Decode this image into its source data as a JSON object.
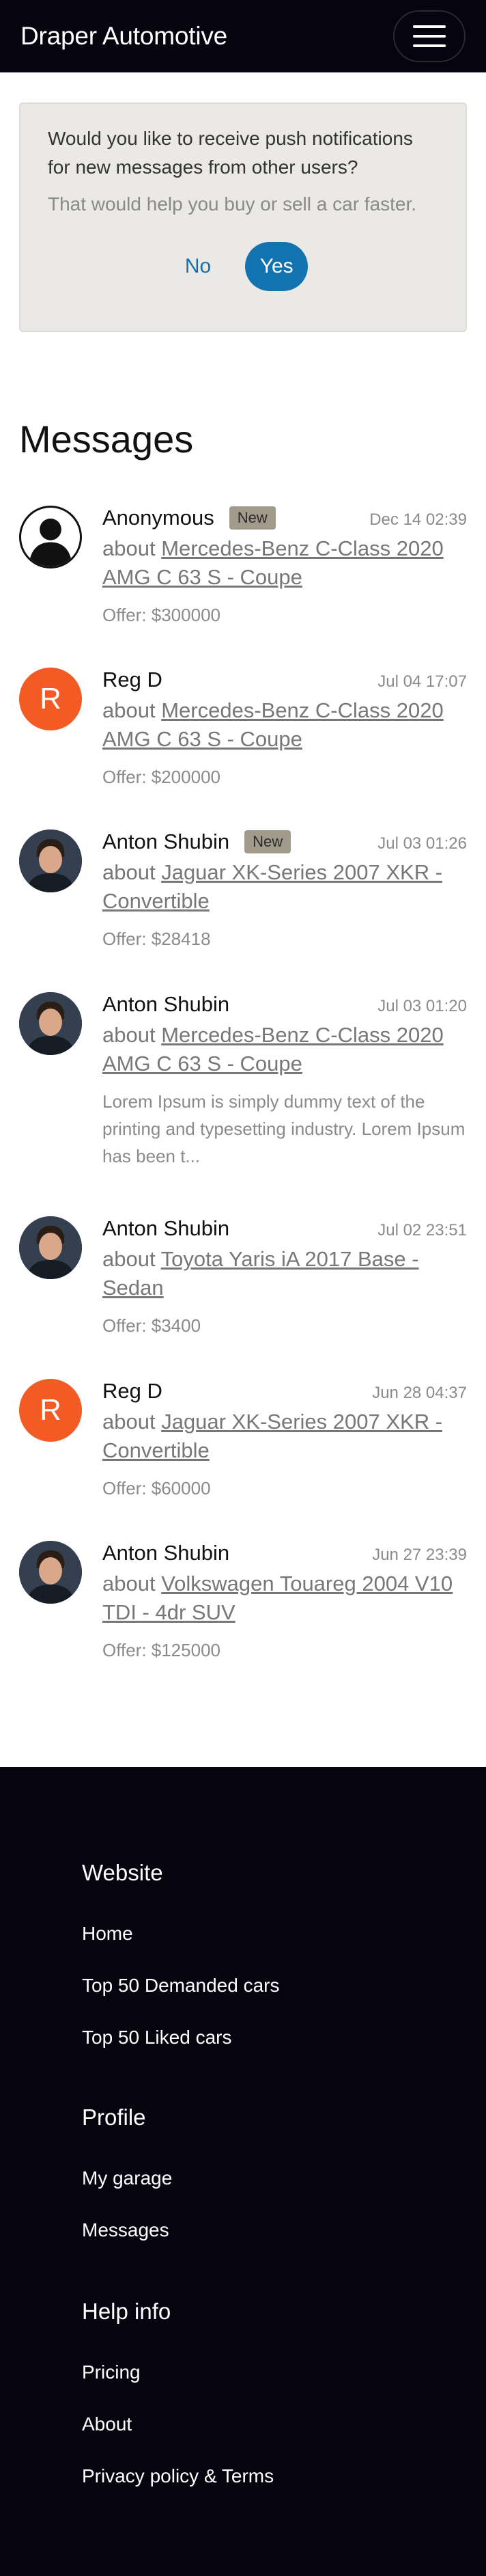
{
  "header": {
    "brand": "Draper Automotive",
    "menu_icon": "hamburger-icon"
  },
  "notification": {
    "question": "Would you like to receive push notifications for new messages from other users?",
    "hint": "That would help you buy or sell a car faster.",
    "no_label": "No",
    "yes_label": "Yes"
  },
  "page": {
    "title": "Messages"
  },
  "messages": [
    {
      "name": "Anonymous",
      "badge": "New",
      "date": "Dec 14 02:39",
      "about_prefix": "about",
      "car": "Mercedes-Benz C-Class 2020 AMG C 63 S - Coupe",
      "extra": "Offer: $300000",
      "avatar": "silhouette-icon"
    },
    {
      "name": "Reg D",
      "badge": "",
      "date": "Jul 04 17:07",
      "about_prefix": "about",
      "car": "Mercedes-Benz C-Class 2020 AMG C 63 S - Coupe",
      "extra": "Offer: $200000",
      "avatar_letter": "R"
    },
    {
      "name": "Anton Shubin",
      "badge": "New",
      "date": "Jul 03 01:26",
      "about_prefix": "about",
      "car": "Jaguar XK-Series 2007 XKR - Convertible",
      "extra": "Offer: $28418",
      "avatar": "user-photo"
    },
    {
      "name": "Anton Shubin",
      "badge": "",
      "date": "Jul 03 01:20",
      "about_prefix": "about",
      "car": "Mercedes-Benz C-Class 2020 AMG C 63 S - Coupe",
      "extra": "Lorem Ipsum is simply dummy text of the printing and typesetting industry. Lorem Ipsum has been t...",
      "avatar": "user-photo"
    },
    {
      "name": "Anton Shubin",
      "badge": "",
      "date": "Jul 02 23:51",
      "about_prefix": "about",
      "car": "Toyota Yaris iA 2017 Base - Sedan",
      "extra": "Offer: $3400",
      "avatar": "user-photo"
    },
    {
      "name": "Reg D",
      "badge": "",
      "date": "Jun 28 04:37",
      "about_prefix": "about",
      "car": "Jaguar XK-Series 2007 XKR - Convertible",
      "extra": "Offer: $60000",
      "avatar_letter": "R"
    },
    {
      "name": "Anton Shubin",
      "badge": "",
      "date": "Jun 27 23:39",
      "about_prefix": "about",
      "car": "Volkswagen Touareg 2004 V10 TDI - 4dr SUV",
      "extra": "Offer: $125000",
      "avatar": "user-photo"
    }
  ],
  "footer": {
    "website": {
      "title": "Website",
      "links": [
        "Home",
        "Top 50 Demanded cars",
        "Top 50 Liked cars"
      ]
    },
    "profile": {
      "title": "Profile",
      "links": [
        "My garage",
        "Messages"
      ]
    },
    "help": {
      "title": "Help info",
      "links": [
        "Pricing",
        "About",
        "Privacy policy & Terms"
      ]
    }
  },
  "colors": {
    "header_bg": "#06040f",
    "accent": "#1373b0",
    "avatar_letter_bg": "#f35a24",
    "badge_bg": "#a29a8b",
    "notify_bg": "#ebe9e5"
  }
}
